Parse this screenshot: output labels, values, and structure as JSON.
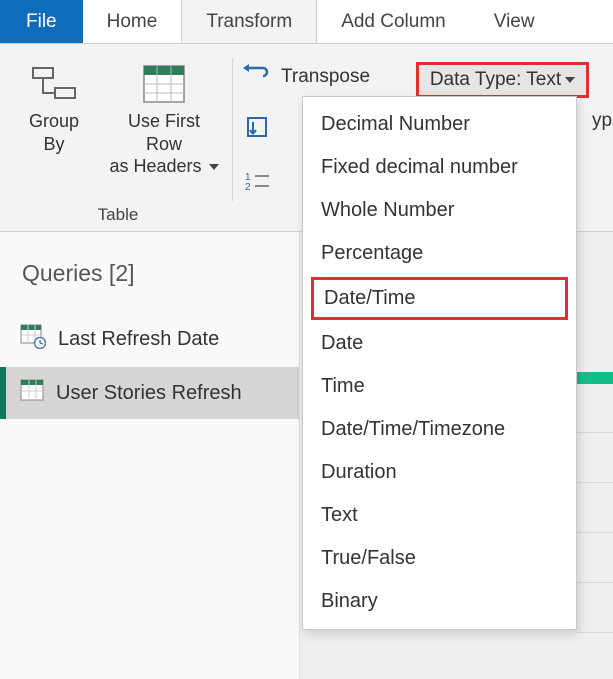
{
  "tabs": {
    "file": "File",
    "home": "Home",
    "transform": "Transform",
    "add_column": "Add Column",
    "view": "View"
  },
  "ribbon": {
    "group_by": {
      "label": "Group\nBy"
    },
    "use_first_row": {
      "label": "Use First Row\nas Headers"
    },
    "transpose_label": "Transpose",
    "table_group_label": "Table",
    "data_type_button": "Data Type: Text",
    "trailing_fragment": "yp"
  },
  "queries": {
    "header": "Queries [2]",
    "items": [
      {
        "label": "Last Refresh Date",
        "selected": false
      },
      {
        "label": "User Stories Refresh",
        "selected": true
      }
    ]
  },
  "data_type_menu": [
    "Decimal Number",
    "Fixed decimal number",
    "Whole Number",
    "Percentage",
    "Date/Time",
    "Date",
    "Time",
    "Date/Time/Timezone",
    "Duration",
    "Text",
    "True/False",
    "Binary"
  ],
  "highlighted_menu_item": "Date/Time"
}
